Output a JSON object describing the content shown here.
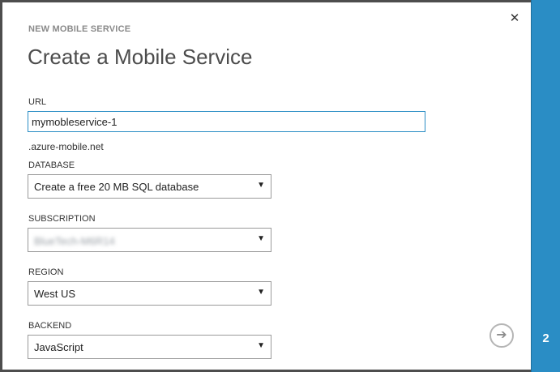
{
  "dialog": {
    "wizard_label": "NEW MOBILE SERVICE",
    "title": "Create a Mobile Service",
    "close_icon": "close-icon",
    "step_number": "2"
  },
  "fields": {
    "url": {
      "label": "URL",
      "value": "mymobleservice-1",
      "suffix": ".azure-mobile.net"
    },
    "database": {
      "label": "DATABASE",
      "selected": "Create a free 20 MB SQL database"
    },
    "subscription": {
      "label": "SUBSCRIPTION",
      "selected": "BlueTech-M6R14"
    },
    "region": {
      "label": "REGION",
      "selected": "West US"
    },
    "backend": {
      "label": "BACKEND",
      "selected": "JavaScript"
    }
  },
  "icons": {
    "dropdown": "chevron-down-icon",
    "next": "arrow-right-icon"
  },
  "colors": {
    "accent": "#2a8dc5",
    "frame": "#4d4d4d"
  }
}
